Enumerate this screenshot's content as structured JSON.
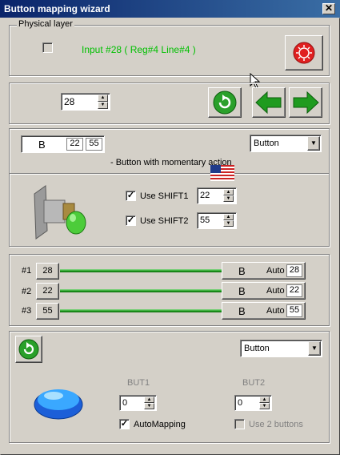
{
  "window": {
    "title": "Button mapping wizard",
    "close_glyph": "✕"
  },
  "physical": {
    "group_label": "Physical layer",
    "input_text": "Input #28  ( Reg#4  Line#4 )",
    "input_color": "#00c000"
  },
  "nav": {
    "input_value": "28"
  },
  "mode": {
    "key_label": "B",
    "key_val1": "22",
    "key_val2": "55",
    "type_select": "Button",
    "description": "- Button with momentary action",
    "shift1_label": "Use SHIFT1",
    "shift1_value": "22",
    "shift2_label": "Use SHIFT2",
    "shift2_value": "55"
  },
  "mappings": [
    {
      "index": "#1",
      "num": "28",
      "key": "B",
      "mode": "Auto",
      "val": "28"
    },
    {
      "index": "#2",
      "num": "22",
      "key": "B",
      "mode": "Auto",
      "val": "22"
    },
    {
      "index": "#3",
      "num": "55",
      "key": "B",
      "mode": "Auto",
      "val": "55"
    }
  ],
  "bottom": {
    "type_select": "Button",
    "but1_label": "BUT1",
    "but1_value": "0",
    "but2_label": "BUT2",
    "but2_value": "0",
    "automapping_label": "AutoMapping",
    "use2_label": "Use 2 buttons"
  }
}
